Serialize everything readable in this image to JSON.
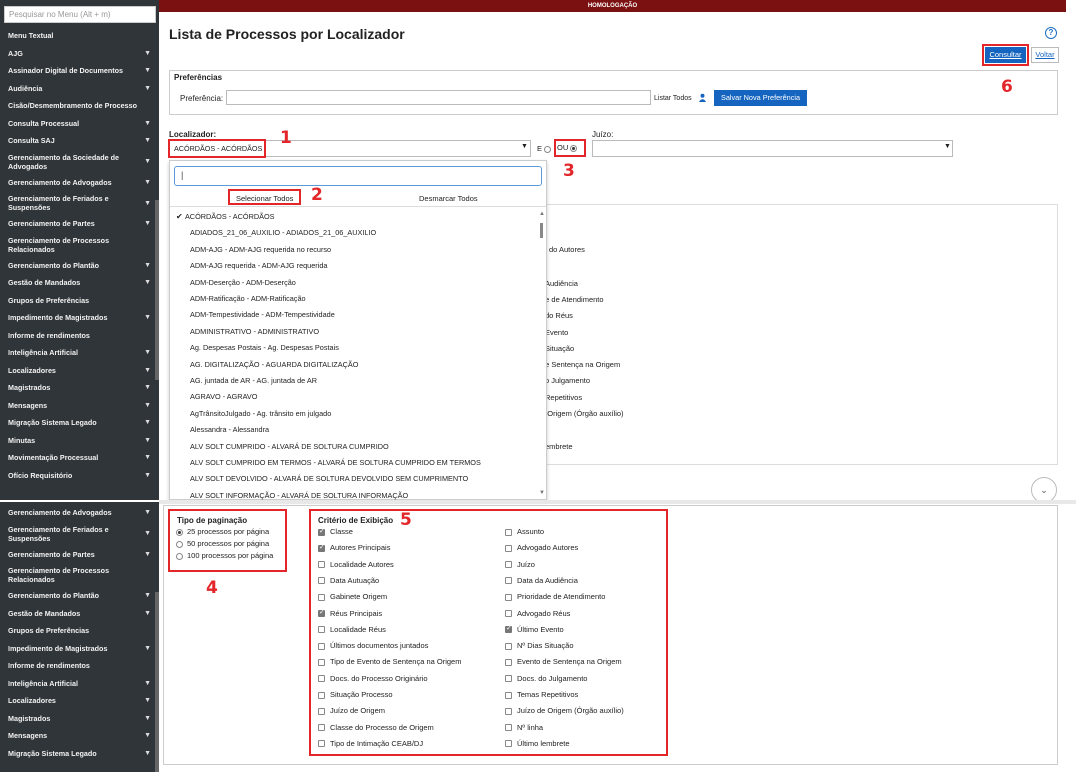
{
  "top_stripe": "HOMOLOGAÇÃO",
  "page_title": "Lista de Processos por Localizador",
  "menu_search_placeholder": "Pesquisar no Menu (Alt + m)",
  "sidebar_top": [
    {
      "label": "Menu Textual",
      "chev": false
    },
    {
      "label": "AJG",
      "chev": true
    },
    {
      "label": "Assinador Digital de Documentos",
      "chev": true
    },
    {
      "label": "Audiência",
      "chev": true
    },
    {
      "label": "Cisão/Desmembramento de Processo",
      "chev": false
    },
    {
      "label": "Consulta Processual",
      "chev": true
    },
    {
      "label": "Consulta SAJ",
      "chev": true
    },
    {
      "label": "Gerenciamento da Sociedade de Advogados",
      "chev": true
    },
    {
      "label": "Gerenciamento de Advogados",
      "chev": true
    },
    {
      "label": "Gerenciamento de Feriados e Suspensões",
      "chev": true
    },
    {
      "label": "Gerenciamento de Partes",
      "chev": true
    },
    {
      "label": "Gerenciamento de Processos Relacionados",
      "chev": false
    },
    {
      "label": "Gerenciamento do Plantão",
      "chev": true
    },
    {
      "label": "Gestão de Mandados",
      "chev": true
    },
    {
      "label": "Grupos de Preferências",
      "chev": false
    },
    {
      "label": "Impedimento de Magistrados",
      "chev": true
    },
    {
      "label": "Informe de rendimentos",
      "chev": false
    },
    {
      "label": "Inteligência Artificial",
      "chev": true
    },
    {
      "label": "Localizadores",
      "chev": true
    },
    {
      "label": "Magistrados",
      "chev": true
    },
    {
      "label": "Mensagens",
      "chev": true
    },
    {
      "label": "Migração Sistema Legado",
      "chev": true
    },
    {
      "label": "Minutas",
      "chev": true
    },
    {
      "label": "Movimentação Processual",
      "chev": true
    },
    {
      "label": "Ofício Requisitório",
      "chev": true
    }
  ],
  "sidebar_bottom": [
    {
      "label": "Gerenciamento de Advogados",
      "chev": true
    },
    {
      "label": "Gerenciamento de Feriados e Suspensões",
      "chev": true
    },
    {
      "label": "Gerenciamento de Partes",
      "chev": true
    },
    {
      "label": "Gerenciamento de Processos Relacionados",
      "chev": false
    },
    {
      "label": "Gerenciamento do Plantão",
      "chev": true
    },
    {
      "label": "Gestão de Mandados",
      "chev": true
    },
    {
      "label": "Grupos de Preferências",
      "chev": false
    },
    {
      "label": "Impedimento de Magistrados",
      "chev": true
    },
    {
      "label": "Informe de rendimentos",
      "chev": false
    },
    {
      "label": "Inteligência Artificial",
      "chev": true
    },
    {
      "label": "Localizadores",
      "chev": true
    },
    {
      "label": "Magistrados",
      "chev": true
    },
    {
      "label": "Mensagens",
      "chev": true
    },
    {
      "label": "Migração Sistema Legado",
      "chev": true
    }
  ],
  "buttons": {
    "consultar": "Consultar",
    "voltar": "Voltar",
    "salvar": "Salvar Nova Preferência"
  },
  "preferencias": {
    "title": "Preferências",
    "label": "Preferência:",
    "listar_todos": "Listar Todos"
  },
  "localizador": {
    "label": "Localizador:",
    "value": "ACÓRDÃOS - ACÓRDÃOS",
    "e": "E",
    "ou": "OU"
  },
  "juizo": {
    "label": "Juízo:"
  },
  "dropdown": {
    "search_value": "|",
    "select_all": "Selecionar Todos",
    "deselect_all": "Desmarcar Todos",
    "options": [
      "ACÓRDÃOS - ACÓRDÃOS",
      "ADIADOS_21_06_AUXILIO - ADIADOS_21_06_AUXILIO",
      "ADM-AJG - ADM-AJG requerida no recurso",
      "ADM-AJG requerida - ADM-AJG requerida",
      "ADM-Deserção - ADM-Deserção",
      "ADM-Ratificação - ADM-Ratificação",
      "ADM-Tempestividade - ADM-Tempestividade",
      "ADMINISTRATIVO - ADMINISTRATIVO",
      "Ag. Despesas Postais - Ag. Despesas Postais",
      "AG. DIGITALIZAÇÃO - AGUARDA DIGITALIZAÇÃO",
      "AG. juntada de AR - AG. juntada de AR",
      "AGRAVO - AGRAVO",
      "AgTrânsitoJulgado - Ag. trânsito em julgado",
      "Alessandra - Alessandra",
      "ALV SOLT CUMPRIDO - ALVARÁ DE SOLTURA CUMPRIDO",
      "ALV SOLT CUMPRIDO EM TERMOS - ALVARÁ DE SOLTURA CUMPRIDO EM TERMOS",
      "ALV SOLT DEVOLVIDO - ALVARÁ DE SOLTURA DEVOLVIDO SEM CUMPRIMENTO",
      "ALV SOLT INFORMAÇÃO - ALVARÁ DE SOLTURA INFORMAÇÃO"
    ]
  },
  "background_texts": [
    "do Autores",
    "Audiência",
    "de de Atendimento",
    "do Réus",
    "Evento",
    "Situação",
    "de Sentença na Origem",
    "o Julgamento",
    "Repetitivos",
    "e Origem (Órgão auxílio)",
    "embrete"
  ],
  "annotations": [
    "1",
    "2",
    "3",
    "4",
    "5",
    "6"
  ],
  "paginacao": {
    "title": "Tipo de paginação",
    "options": [
      {
        "label": "25 processos por página",
        "checked": true
      },
      {
        "label": "50 processos por página",
        "checked": false
      },
      {
        "label": "100 processos por página",
        "checked": false
      }
    ]
  },
  "criterio": {
    "title": "Critério de Exibição",
    "col1": [
      {
        "label": "Classe",
        "checked": true
      },
      {
        "label": "Autores Principais",
        "checked": true
      },
      {
        "label": "Localidade Autores",
        "checked": false
      },
      {
        "label": "Data Autuação",
        "checked": false
      },
      {
        "label": "Gabinete Origem",
        "checked": false
      },
      {
        "label": "Réus Principais",
        "checked": true
      },
      {
        "label": "Localidade Réus",
        "checked": false
      },
      {
        "label": "Últimos documentos juntados",
        "checked": false
      },
      {
        "label": "Tipo de Evento de Sentença na Origem",
        "checked": false
      },
      {
        "label": "Docs. do Processo Originário",
        "checked": false
      },
      {
        "label": "Situação Processo",
        "checked": false
      },
      {
        "label": "Juízo de Origem",
        "checked": false
      },
      {
        "label": "Classe do Processo de Origem",
        "checked": false
      },
      {
        "label": "Tipo de Intimação CEAB/DJ",
        "checked": false
      }
    ],
    "col2": [
      {
        "label": "Assunto",
        "checked": false
      },
      {
        "label": "Advogado Autores",
        "checked": false
      },
      {
        "label": "Juízo",
        "checked": false
      },
      {
        "label": "Data da Audiência",
        "checked": false
      },
      {
        "label": "Prioridade de Atendimento",
        "checked": false
      },
      {
        "label": "Advogado Réus",
        "checked": false
      },
      {
        "label": "Último Evento",
        "checked": true
      },
      {
        "label": "Nº Dias Situação",
        "checked": false
      },
      {
        "label": "Evento de Sentença na Origem",
        "checked": false
      },
      {
        "label": "Docs. do Julgamento",
        "checked": false
      },
      {
        "label": "Temas Repetitivos",
        "checked": false
      },
      {
        "label": "Juízo de Origem (Órgão auxílio)",
        "checked": false
      },
      {
        "label": "Nº linha",
        "checked": false
      },
      {
        "label": "Último lembrete",
        "checked": false
      }
    ]
  }
}
